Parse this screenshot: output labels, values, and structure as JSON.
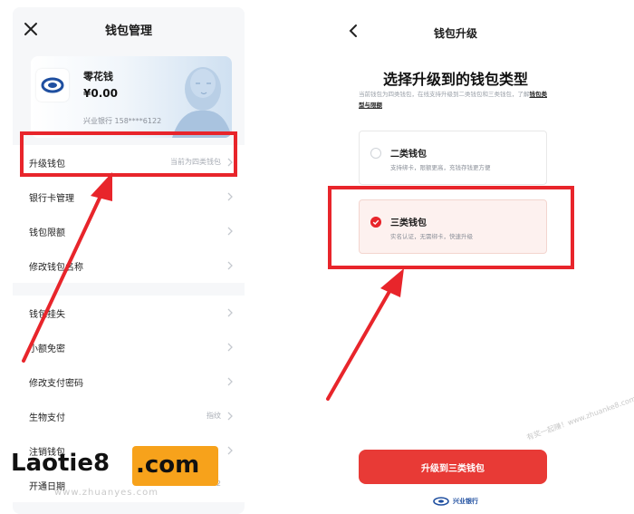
{
  "left": {
    "title": "钱包管理",
    "card": {
      "name": "零花钱",
      "balance": "¥0.00",
      "bank_info": "兴业银行 158****6122"
    },
    "groups": [
      [
        {
          "label": "升级钱包",
          "value": "当前为四类钱包"
        },
        {
          "label": "银行卡管理",
          "value": ""
        },
        {
          "label": "钱包限额",
          "value": ""
        },
        {
          "label": "修改钱包名称",
          "value": ""
        }
      ],
      [
        {
          "label": "钱包挂失",
          "value": ""
        },
        {
          "label": "小额免密",
          "value": ""
        },
        {
          "label": "修改支付密码",
          "value": ""
        },
        {
          "label": "生物支付",
          "value": "指纹"
        },
        {
          "label": "注销钱包",
          "value": ""
        },
        {
          "label": "开通日期",
          "value": "2022"
        }
      ]
    ]
  },
  "right": {
    "title": "钱包升级",
    "heading": "选择升级到的钱包类型",
    "description": "当前钱包为四类钱包，在线支持升级到二类钱包和三类钱包，了解",
    "description_link": "钱包类型与限额",
    "options": [
      {
        "title": "二类钱包",
        "subtitle": "支持绑卡，限额更高，充钱存钱更方便",
        "selected": false
      },
      {
        "title": "三类钱包",
        "subtitle": "实名认证，无需绑卡，快速升级",
        "selected": true
      }
    ],
    "upgrade_button": "升级到三类钱包",
    "bank_logo_text": "兴业银行"
  },
  "watermark": {
    "site": "Laotie8",
    "tld": ".com",
    "small": "www.zhuanyes.com",
    "right": "有奖一起赚！www.zhuanke8.com"
  },
  "colors": {
    "accent_red": "#e8252b",
    "button_red": "#e83a36",
    "selected_bg": "#fdf1ef"
  },
  "icons": [
    "close-icon",
    "back-icon",
    "chevron-right-icon",
    "radio-selected-icon",
    "radio-unselected-icon",
    "bank-logo-icon"
  ]
}
